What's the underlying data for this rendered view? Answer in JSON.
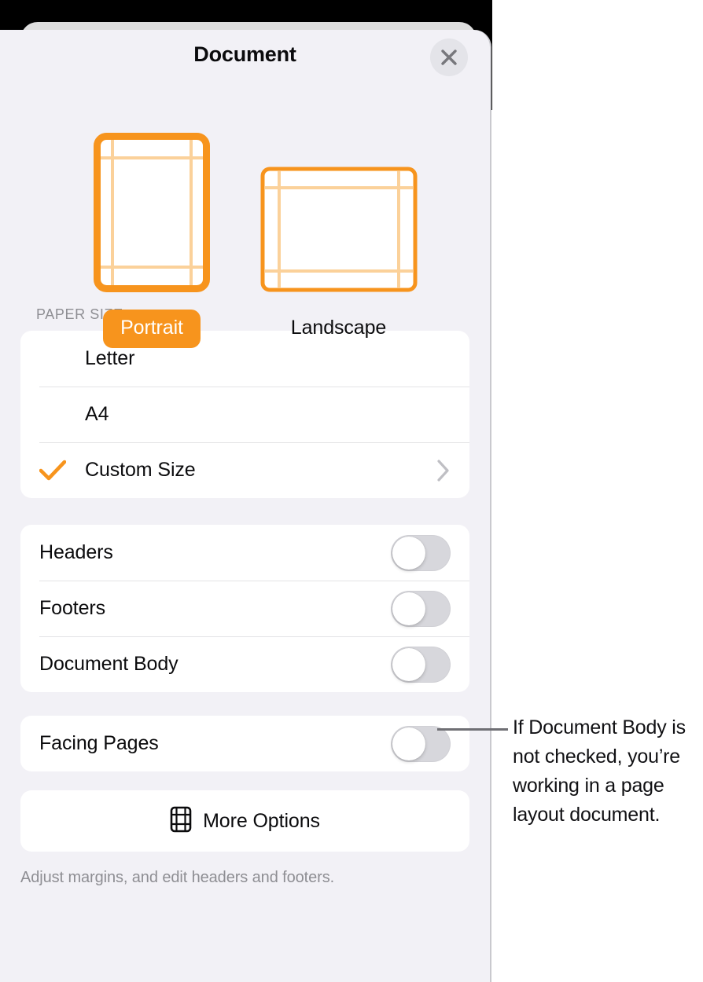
{
  "header": {
    "title": "Document",
    "close_icon": "close-icon"
  },
  "orientation": {
    "options": [
      {
        "label": "Portrait",
        "selected": true,
        "icon": "page-portrait-icon"
      },
      {
        "label": "Landscape",
        "selected": false,
        "icon": "page-landscape-icon"
      }
    ]
  },
  "paper_size": {
    "section_label": "Paper Size",
    "options": [
      {
        "label": "Letter",
        "checked": false,
        "has_chevron": false
      },
      {
        "label": "A4",
        "checked": false,
        "has_chevron": false
      },
      {
        "label": "Custom Size",
        "checked": true,
        "has_chevron": true
      }
    ]
  },
  "toggles_group_1": [
    {
      "label": "Headers",
      "on": false
    },
    {
      "label": "Footers",
      "on": false
    },
    {
      "label": "Document Body",
      "on": false
    }
  ],
  "toggles_group_2": [
    {
      "label": "Facing Pages",
      "on": false
    }
  ],
  "more_options": {
    "label": "More Options",
    "icon": "document-margins-icon"
  },
  "footnote": "Adjust margins, and edit headers and footers.",
  "callout": {
    "text": "If Document Body is not checked, you’re working in a page layout document."
  },
  "colors": {
    "accent": "#f7941d",
    "panel_background": "#f2f1f6",
    "card_background": "#ffffff",
    "toggle_off_track": "#d7d7dc",
    "secondary_text": "#8e8e93"
  }
}
